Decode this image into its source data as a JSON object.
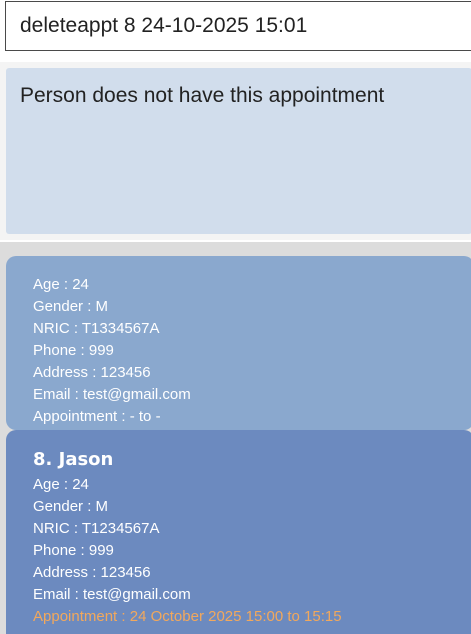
{
  "command_box": {
    "value": "deleteappt 8 24-10-2025 15:01"
  },
  "result_box": {
    "message": "Person does not have this appointment"
  },
  "person_list": {
    "previous_card": {
      "age": "Age : 24",
      "gender": "Gender : M",
      "nric": "NRIC : T1334567A",
      "phone": "Phone : 999",
      "address": "Address : 123456",
      "email": "Email : test@gmail.com",
      "appointment": "Appointment : - to -"
    },
    "selected_card": {
      "title": "8. Jason",
      "age": "Age : 24",
      "gender": "Gender : M",
      "nric": "NRIC : T1234567A",
      "phone": "Phone : 999",
      "address": "Address : 123456",
      "email": "Email : test@gmail.com",
      "appointment": "Appointment : 24 October 2025 15:00 to 15:15"
    }
  },
  "colors": {
    "result_background": "#d1ddec",
    "card_background": "#8aa8ce",
    "selected_card_background": "#6c8abf",
    "appointment_highlight": "#f2a85c"
  }
}
